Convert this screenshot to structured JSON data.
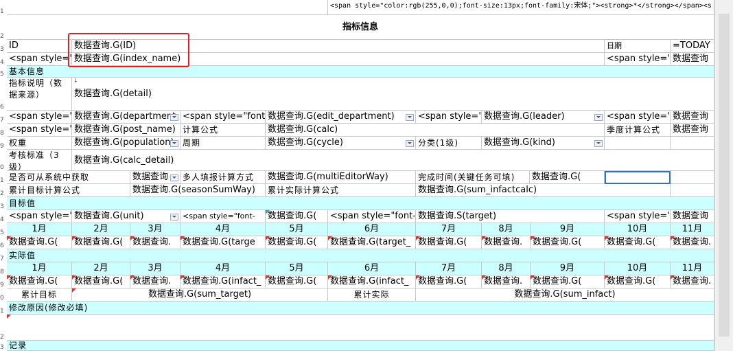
{
  "cells": [
    {
      "id": "r1c1",
      "text": "<span style=\"color:rgb(255,0,0);font-size:13px;font-family:宋体;\"><strong>*</strong></span><s",
      "cls": "code",
      "tri": false
    },
    {
      "id": "title",
      "text": "指标信息"
    },
    {
      "id": "r3c0",
      "text": "ID"
    },
    {
      "id": "r3c1",
      "text": "数据查询.G(ID)"
    },
    {
      "id": "r3c_date",
      "text": "日期"
    },
    {
      "id": "r3c_today",
      "text": "=TODAY"
    },
    {
      "id": "r4c0",
      "text": "<span style=\""
    },
    {
      "id": "r4c1",
      "text": "数据查询.G(index_name)"
    },
    {
      "id": "r4c_span",
      "text": "<span style=\""
    },
    {
      "id": "r4c_q",
      "text": "数据查询"
    },
    {
      "id": "sec_basic",
      "text": "基本信息"
    },
    {
      "id": "r6c0",
      "text": "指标说明（数据来源）"
    },
    {
      "id": "r6c1",
      "text": "数据查询.G(detail)"
    },
    {
      "id": "r7c0",
      "text": "<span style=\""
    },
    {
      "id": "r7c1",
      "text": "数据查询.G(department"
    },
    {
      "id": "r7c2",
      "text": "<span style=\"font-"
    },
    {
      "id": "r7c3",
      "text": "数据查询.G(edit_department)"
    },
    {
      "id": "r7c4",
      "text": "<span style=\""
    },
    {
      "id": "r7c5",
      "text": "数据查询.G(leader)"
    },
    {
      "id": "r7c6",
      "text": "<span style=\""
    },
    {
      "id": "r7c7",
      "text": "数据查询"
    },
    {
      "id": "r8c0",
      "text": "<span style=\""
    },
    {
      "id": "r8c1",
      "text": "数据查询.G(post_name)"
    },
    {
      "id": "r8c2",
      "text": "计算公式"
    },
    {
      "id": "r8c3",
      "text": "数据查询.G(calc)"
    },
    {
      "id": "r8c6",
      "text": "季度计算公式"
    },
    {
      "id": "r8c7",
      "text": "数据查询"
    },
    {
      "id": "r9c0",
      "text": "权重"
    },
    {
      "id": "r9c1",
      "text": "数据查询.G(population)"
    },
    {
      "id": "r9c2",
      "text": "周期"
    },
    {
      "id": "r9c3",
      "text": "数据查询.G(cycle)"
    },
    {
      "id": "r9c4",
      "text": "分类(1级)"
    },
    {
      "id": "r9c5",
      "text": "数据查询.G(kind)"
    },
    {
      "id": "r10c0",
      "text": "考核标准（3级）"
    },
    {
      "id": "r10c1",
      "text": "数据查询.G(calc_detail)"
    },
    {
      "id": "r11c0",
      "text": "是否可从系统中获取"
    },
    {
      "id": "r11c1",
      "text": "数据查询"
    },
    {
      "id": "r11c2",
      "text": "多人填报计算方式"
    },
    {
      "id": "r11c3",
      "text": "数据查询.G(multiEditorWay)"
    },
    {
      "id": "r11c4",
      "text": "完成时间(关键任务可填)"
    },
    {
      "id": "r11c5",
      "text": "数据查询.G("
    },
    {
      "id": "r12c0",
      "text": "累计目标计算公式"
    },
    {
      "id": "r12c1",
      "text": "数据查询.G(seasonSumWay)"
    },
    {
      "id": "r12c2",
      "text": "累计实际计算公式"
    },
    {
      "id": "r12c3",
      "text": "数据查询.G(sum_infactcalc)"
    },
    {
      "id": "sec_target",
      "text": "目标值"
    },
    {
      "id": "r14c0",
      "text": "<span style=\""
    },
    {
      "id": "r14c1",
      "text": "数据查询.G(unit)"
    },
    {
      "id": "r14c2",
      "text": "<span style=\"font-"
    },
    {
      "id": "r14c3",
      "text": "数据查询.G("
    },
    {
      "id": "r14c4",
      "text": "<span style=\"font-"
    },
    {
      "id": "r14c5",
      "text": "数据查询.S(target)"
    },
    {
      "id": "r14c6",
      "text": "<span style=\""
    },
    {
      "id": "r14c7",
      "text": "数据查询"
    }
  ],
  "months": [
    "1月",
    "2月",
    "3月",
    "4月",
    "5月",
    "6月",
    "7月",
    "8月",
    "9月",
    "10月",
    "11月"
  ],
  "target_row": [
    "数据查询.G(",
    "数据查询.G(",
    "数据查询.",
    "数据查询.G(targe",
    "数据查询.G(",
    "数据查询.G(target_",
    "数据查询.G(",
    "数据查询.",
    "数据查询.G(",
    "数据查询.G(",
    "数据查询."
  ],
  "infact_row": [
    "数据查询.G(",
    "数据查询.G(",
    "数据查询.",
    "数据查询.G(infact_",
    "数据查询.G(",
    "数据查询.G(infact_",
    "数据查询.G(",
    "数据查询.",
    "数据查询.G(",
    "数据查询.G(",
    "数据查询."
  ],
  "sec_actual": "实际值",
  "sum_row": {
    "label1": "累计目标",
    "val1": "数据查询.G(sum_target)",
    "label2": "累计实际",
    "val2": "数据查询.G(sum_infact)"
  },
  "sec_reason": "修改原因(修改必填)",
  "sec_record": "记录",
  "row_numbers": [
    "",
    "1",
    "2",
    "3",
    "4",
    "5",
    "6",
    "7",
    "8",
    "9",
    "0",
    "1",
    "2",
    "3",
    "4",
    "5",
    "6",
    "7",
    "8",
    "9",
    "0",
    "1",
    "2",
    "3",
    "4",
    "5",
    "6"
  ],
  "colors": {
    "section_bg": "#ccffff",
    "highlight": "#e02020",
    "selection": "#2b6fd6",
    "comment_marker": "#e03030"
  }
}
